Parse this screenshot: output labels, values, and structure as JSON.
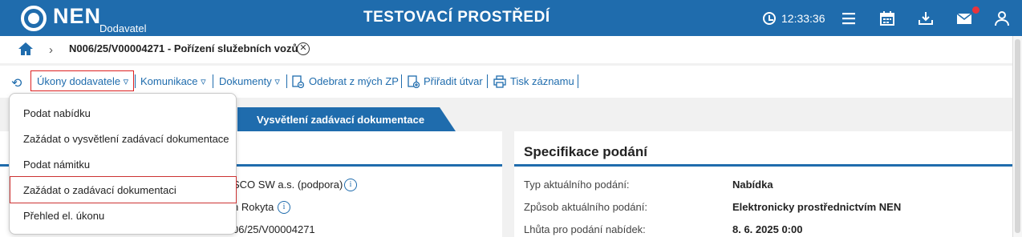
{
  "header": {
    "logo": "NEN",
    "logo_sub": "Dodavatel",
    "environment": "TESTOVACÍ PROSTŘEDÍ",
    "time": "12:33:36",
    "icons": [
      "clock-icon",
      "menu-icon",
      "calendar-icon",
      "download-icon",
      "mail-icon",
      "user-icon"
    ],
    "accent": "#1f6cad"
  },
  "breadcrumb": {
    "title": "N006/25/V00004271 - Pořízení služebních vozů"
  },
  "toolbar": {
    "ukony": "Úkony dodavatele ▿",
    "komunikace": "Komunikace ▿",
    "dokumenty": "Dokumenty ▿",
    "odebrat": "Odebrat z mých ZP",
    "priradit": "Přiřadit útvar",
    "tisk": "Tisk záznamu"
  },
  "menu": {
    "items": [
      "Podat nabídku",
      "Zažádat o vysvětlení zadávací dokumentace",
      "Podat námitku",
      "Zažádat o zadávací dokumentaci",
      "Přehled el. úkonu"
    ]
  },
  "tab": {
    "label": "Vysvětlení zadávací dokumentace"
  },
  "left_panel": {
    "rows": [
      "SCO SW a.s. (podpora)",
      "n Rokyta",
      "06/25/V00004271"
    ]
  },
  "spec": {
    "title": "Specifikace podání",
    "rows": [
      {
        "label": "Typ aktuálního podání:",
        "value": "Nabídka"
      },
      {
        "label": "Způsob aktuálního podání:",
        "value": "Elektronicky prostřednictvím NEN"
      },
      {
        "label": "Lhůta pro podání nabídek:",
        "value": "8. 6. 2025 0:00"
      }
    ]
  }
}
